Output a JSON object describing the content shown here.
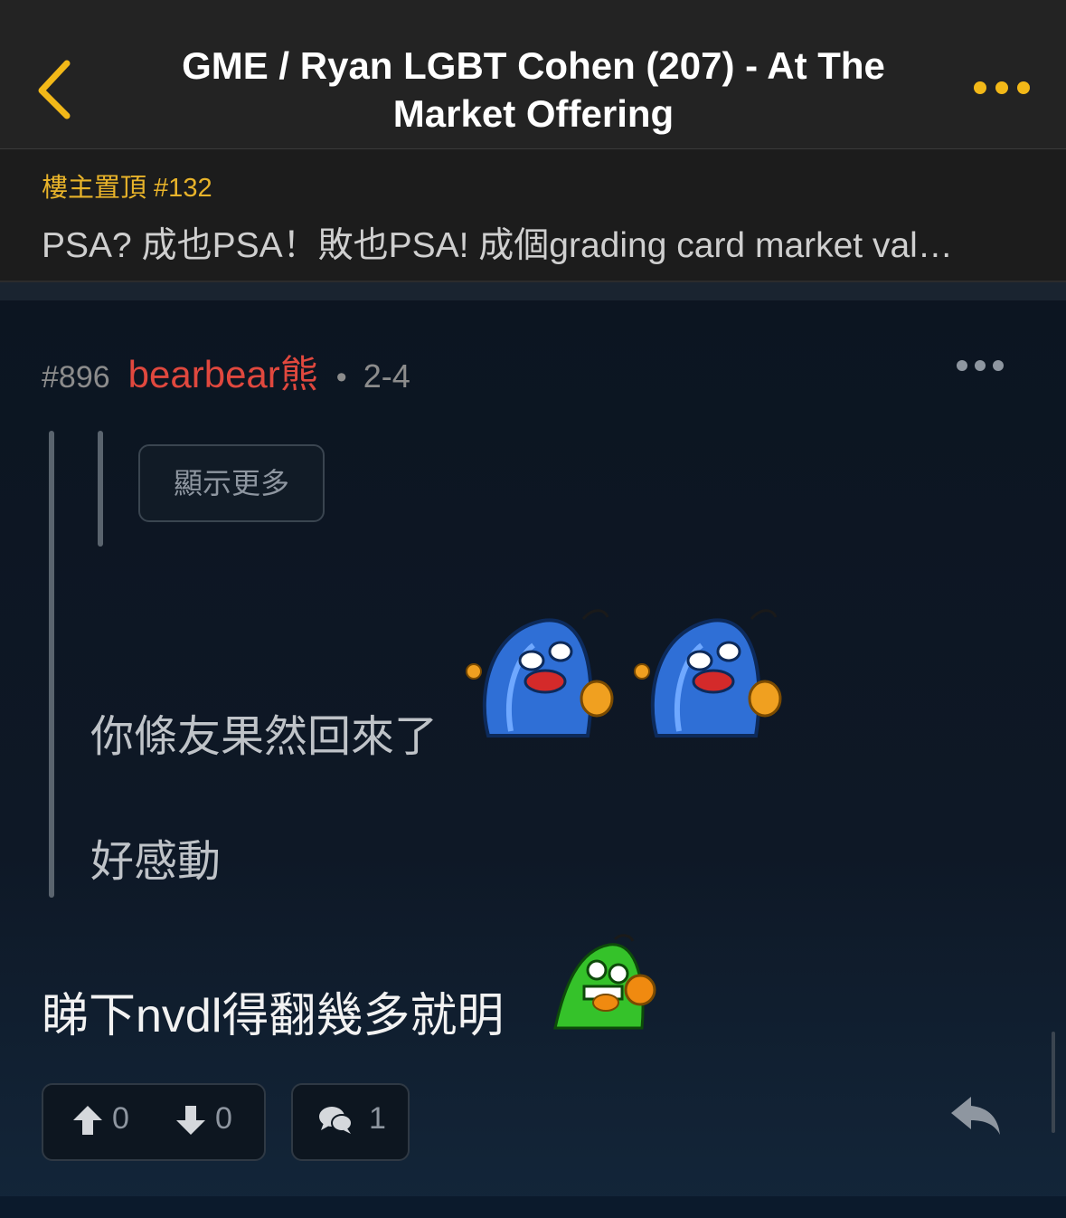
{
  "header": {
    "title_line1": "GME / Ryan LGBT Cohen (207) - At The",
    "title_line2": "Market Offering",
    "back_icon": "chevron-left-icon",
    "more_icon": "more-horizontal-icon",
    "accent_color": "#f2b818"
  },
  "pinned": {
    "label": "樓主置頂 #132",
    "text": "PSA? 成也PSA！敗也PSA! 成個grading card market val…"
  },
  "post": {
    "number": "#896",
    "username": "bearbear熊",
    "dot": "•",
    "time": "2-4",
    "username_color": "#e0483e",
    "quote": {
      "show_more_label": "顯示更多",
      "line1": "你條友果然回來了",
      "line2": "好感動"
    },
    "body": "睇下nvdl得翻幾多就明",
    "upvotes": "0",
    "downvotes": "0",
    "replies": "1",
    "icons": [
      "thumb-up-arrow-icon",
      "thumb-down-arrow-icon",
      "comments-icon",
      "reply-icon",
      "crying-blue-sticker",
      "laughing-green-sticker"
    ]
  }
}
